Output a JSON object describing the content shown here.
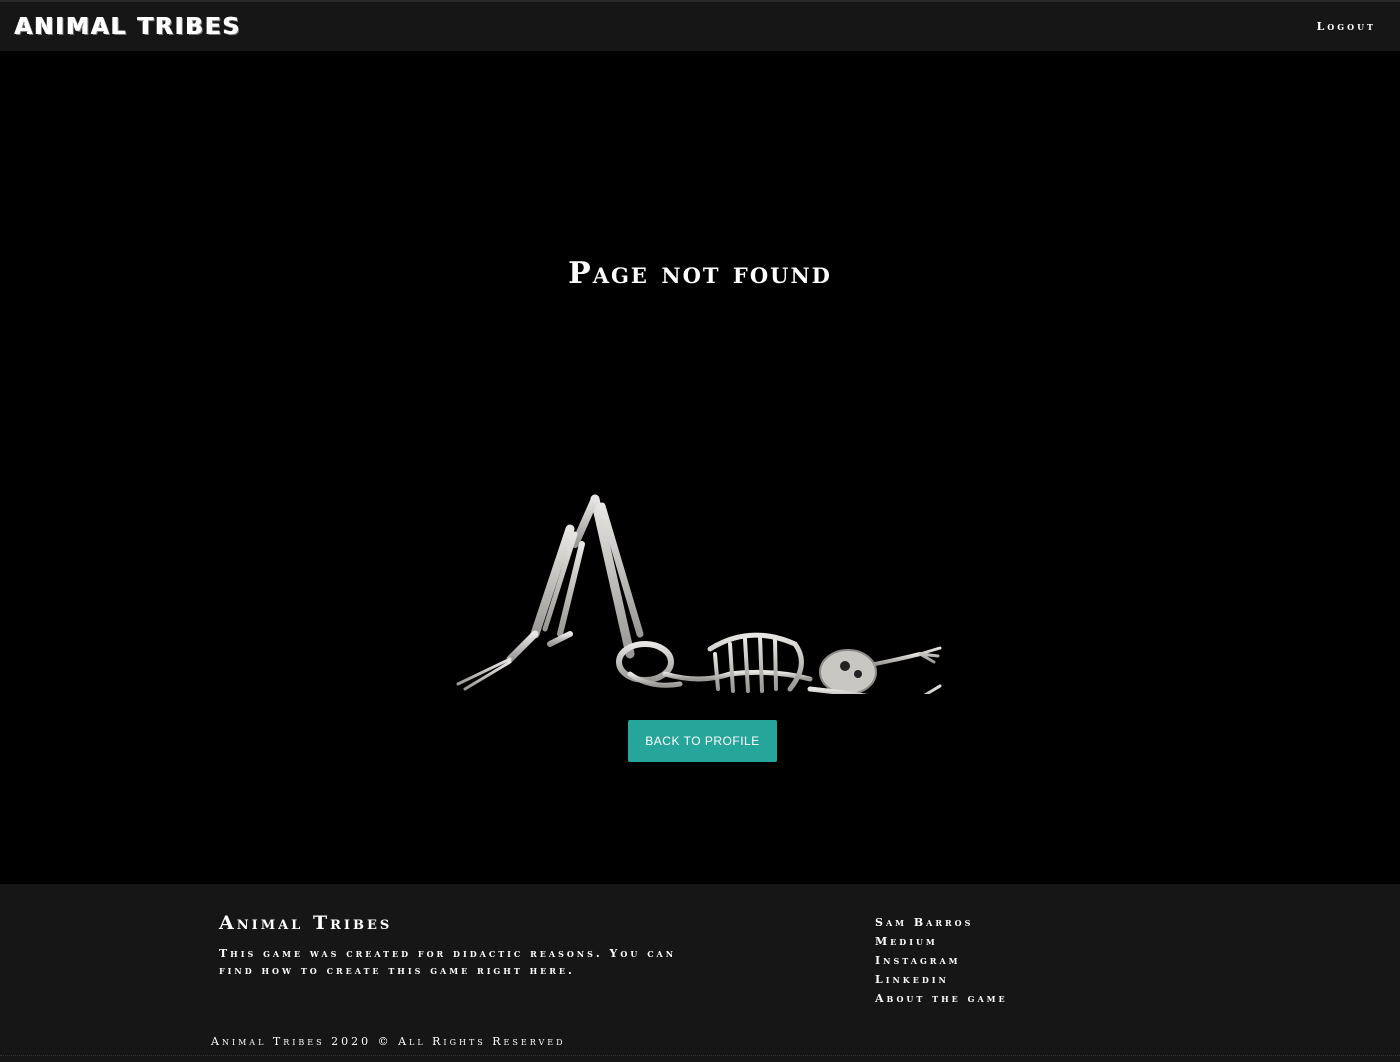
{
  "nav": {
    "brand": "ANIMAL TRIBES",
    "logout": "Logout"
  },
  "main": {
    "title": "Page not found",
    "illustration_icon": "skeleton-lying-down",
    "back_button": "BACK TO PROFILE",
    "accent_color": "#26a69a"
  },
  "footer": {
    "title": "Animal Tribes",
    "description": "This game was created for didactic reasons. You can find how to create this game right here.",
    "links": [
      "Sam Barros",
      "Medium",
      "Instagram",
      "Linkedin",
      "About the game"
    ],
    "copyright": "Animal Tribes 2020 © All Rights Reserved"
  }
}
